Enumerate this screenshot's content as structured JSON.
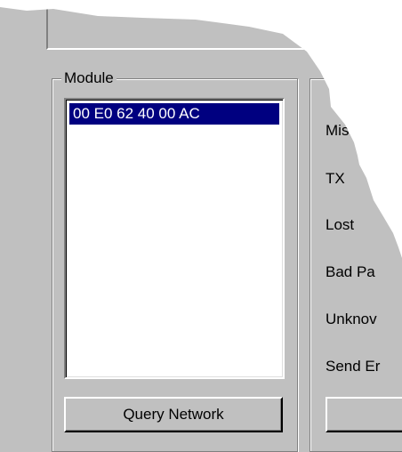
{
  "module_group": {
    "title": "Module",
    "list_items": [
      "00 E0 62 40 00 AC"
    ],
    "query_button_label": "Query Network"
  },
  "stats_group": {
    "labels": [
      "Mis",
      "TX",
      "Lost",
      "Bad Pa",
      "Unknov",
      "Send Er"
    ]
  },
  "colors": {
    "face": "#c0c0c0",
    "selection": "#000080",
    "shadow": "#808080"
  }
}
